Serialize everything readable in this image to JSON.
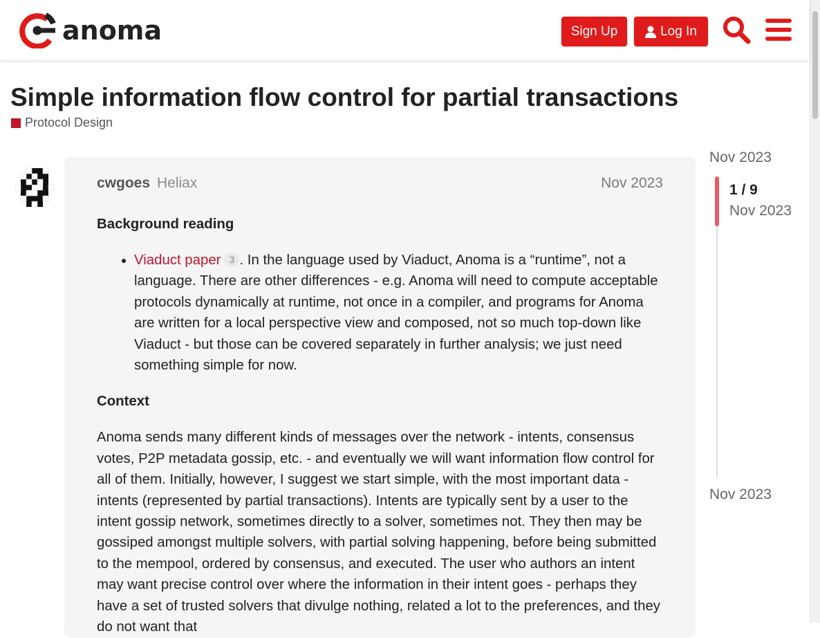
{
  "header": {
    "logo_text": "anoma",
    "signup_label": "Sign Up",
    "login_label": "Log In",
    "accent_color": "#e01b1b"
  },
  "topic": {
    "title": "Simple information flow control for partial transactions",
    "category": "Protocol Design",
    "category_color": "#c0152a"
  },
  "post": {
    "author": "cwgoes",
    "org": "Heliax",
    "date": "Nov 2023",
    "heading_background": "Background reading",
    "link_text": "Viaduct paper",
    "link_clicks": "3",
    "bullet_text": ". In the language used by Viaduct, Anoma is a “runtime”, not a language. There are other differences - e.g. Anoma will need to compute acceptable protocols dynamically at runtime, not once in a compiler, and programs for Anoma are written for a local perspective view and composed, not so much top-down like Viaduct - but those can be covered separately in further analysis; we just need something simple for now.",
    "heading_context": "Context",
    "context_text": "Anoma sends many different kinds of messages over the network - intents, consensus votes, P2P metadata gossip, etc. - and eventually we will want information flow control for all of them. Initially, however, I suggest we start simple, with the most important data - intents (represented by partial transactions). Intents are typically sent by a user to the intent gossip network, sometimes directly to a solver, sometimes not. They then may be gossiped amongst multiple solvers, with partial solving happening, before being submitted to the mempool, ordered by consensus, and executed. The user who authors an intent may want precise control over where the information in their intent goes - perhaps they have a set of trusted solvers that divulge nothing, related a lot to the preferences, and they do not want that"
  },
  "timeline": {
    "top_date": "Nov 2023",
    "count": "1 / 9",
    "current_date": "Nov 2023",
    "bottom_date": "Nov 2023"
  }
}
